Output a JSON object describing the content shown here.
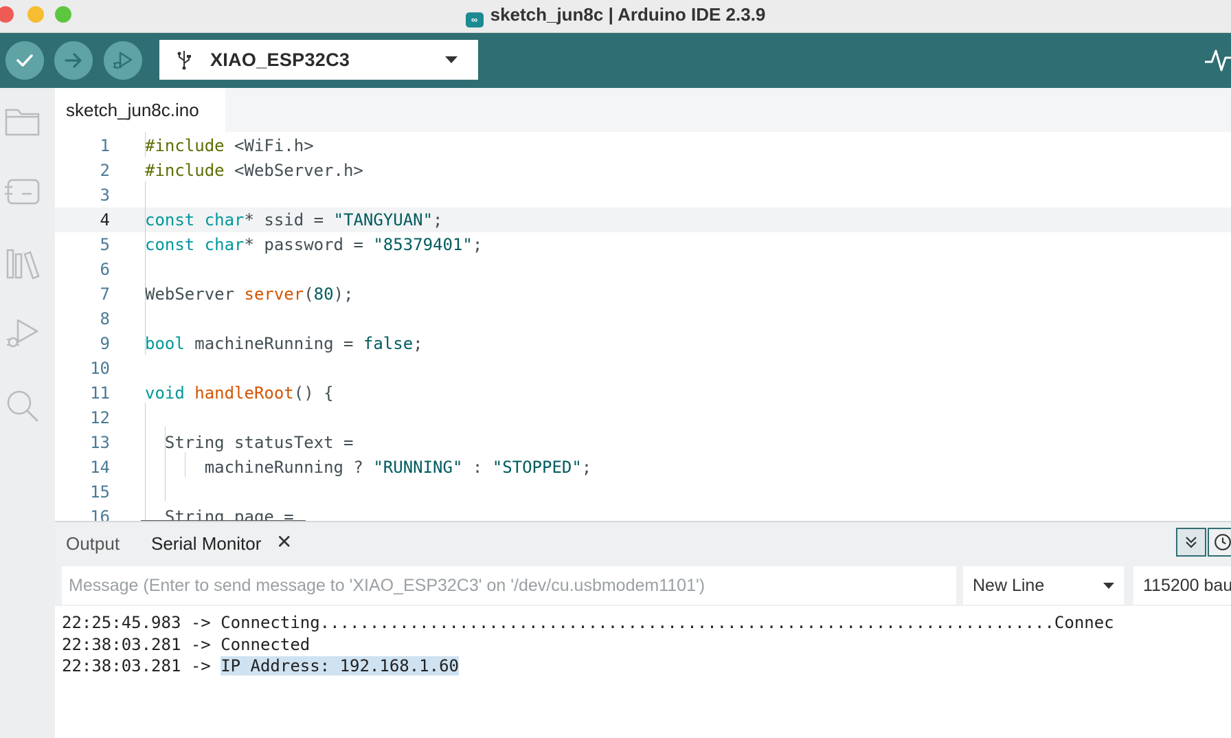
{
  "window": {
    "title": "sketch_jun8c | Arduino IDE 2.3.9"
  },
  "toolbar": {
    "verify_icon": "check-icon",
    "upload_icon": "arrow-right-icon",
    "debug_icon": "debug-play-icon",
    "board_name": "XIAO_ESP32C3",
    "serial_plotter_icon": "pulse-icon"
  },
  "sidebar": {
    "items": [
      "folder-icon",
      "board-manager-icon",
      "library-icon",
      "debug-icon",
      "search-icon"
    ]
  },
  "editor": {
    "tab_label": "sketch_jun8c.ino",
    "active_line": 4,
    "lines": [
      {
        "n": "1",
        "segs": [
          [
            "pp",
            "#include"
          ],
          [
            "df",
            " <WiFi.h>"
          ]
        ]
      },
      {
        "n": "2",
        "segs": [
          [
            "pp",
            "#include"
          ],
          [
            "df",
            " <WebServer.h>"
          ]
        ]
      },
      {
        "n": "3",
        "segs": []
      },
      {
        "n": "4",
        "segs": [
          [
            "ty",
            "const"
          ],
          [
            "df",
            " "
          ],
          [
            "ty",
            "char"
          ],
          [
            "df",
            "* ssid = "
          ],
          [
            "st",
            "\"TANGYUAN\""
          ],
          [
            "df",
            ";"
          ]
        ]
      },
      {
        "n": "5",
        "segs": [
          [
            "ty",
            "const"
          ],
          [
            "df",
            " "
          ],
          [
            "ty",
            "char"
          ],
          [
            "df",
            "* password = "
          ],
          [
            "st",
            "\"85379401\""
          ],
          [
            "df",
            ";"
          ]
        ]
      },
      {
        "n": "6",
        "segs": []
      },
      {
        "n": "7",
        "segs": [
          [
            "df",
            "WebServer "
          ],
          [
            "fn",
            "server"
          ],
          [
            "df",
            "("
          ],
          [
            "nm",
            "80"
          ],
          [
            "df",
            ");"
          ]
        ]
      },
      {
        "n": "8",
        "segs": []
      },
      {
        "n": "9",
        "segs": [
          [
            "ty",
            "bool"
          ],
          [
            "df",
            " machineRunning = "
          ],
          [
            "nm",
            "false"
          ],
          [
            "df",
            ";"
          ]
        ]
      },
      {
        "n": "10",
        "segs": []
      },
      {
        "n": "11",
        "segs": [
          [
            "ty",
            "void"
          ],
          [
            "df",
            " "
          ],
          [
            "fn",
            "handleRoot"
          ],
          [
            "df",
            "() {"
          ]
        ]
      },
      {
        "n": "12",
        "segs": []
      },
      {
        "n": "13",
        "segs": [
          [
            "df",
            "  String statusText ="
          ]
        ]
      },
      {
        "n": "14",
        "segs": [
          [
            "df",
            "      machineRunning ? "
          ],
          [
            "st",
            "\"RUNNING\""
          ],
          [
            "df",
            " : "
          ],
          [
            "st",
            "\"STOPPED\""
          ],
          [
            "df",
            ";"
          ]
        ]
      },
      {
        "n": "15",
        "segs": []
      },
      {
        "n": "16",
        "segs": [
          [
            "df",
            "  String page ="
          ]
        ]
      }
    ]
  },
  "panel": {
    "tab_output": "Output",
    "tab_serial": "Serial Monitor",
    "close_glyph": "✕",
    "message_placeholder": "Message (Enter to send message to 'XIAO_ESP32C3' on '/dev/cu.usbmodem1101')",
    "line_ending": "New Line",
    "baud_rate": "115200 bau",
    "output": [
      {
        "ts": "22:25:45.983 -> ",
        "text": "Connecting..........................................................................Connec",
        "selected": false
      },
      {
        "ts": "22:38:03.281 -> ",
        "text": "Connected",
        "selected": false
      },
      {
        "ts": "22:38:03.281 -> ",
        "text": "IP Address: 192.168.1.60",
        "selected": true
      }
    ]
  }
}
